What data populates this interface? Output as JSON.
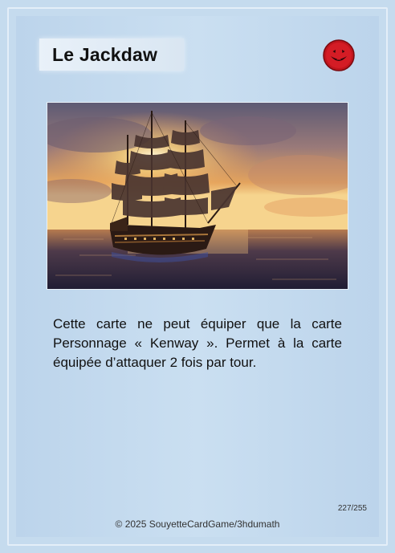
{
  "card": {
    "title": "Le Jackdaw",
    "description": "Cette carte ne peut équiper que la carte Personnage « Kenway ». Permet à la carte équipée d’attaquer 2 fois par tour.",
    "number": "227/255",
    "copyright": "© 2025 SouyetteCardGame/3hdumath"
  },
  "illustration": "pirate ship sailing at sunset on the ocean",
  "emblem": {
    "icon": "smiling-red-face-icon",
    "color": "#c0151d"
  },
  "colors": {
    "card_background": "#c5dbee",
    "title_box": "#e6eff8"
  }
}
